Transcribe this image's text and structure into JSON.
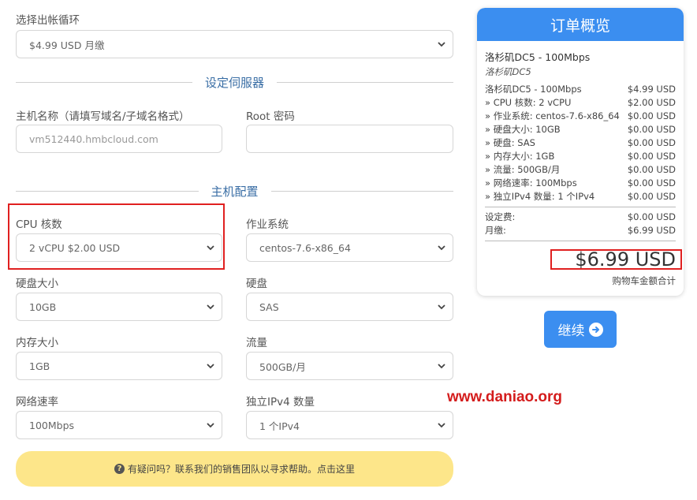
{
  "billing": {
    "label": "选择出帐循环",
    "value": "$4.99 USD 月缴"
  },
  "server_section": {
    "title": "设定伺服器"
  },
  "hostname": {
    "label": "主机名称（请填写域名/子域名格式）",
    "placeholder": "vm512440.hmbcloud.com"
  },
  "root_password": {
    "label": "Root 密码",
    "value": ""
  },
  "config_section": {
    "title": "主机配置"
  },
  "fields": {
    "cpu": {
      "label": "CPU 核数",
      "value": "2 vCPU $2.00 USD"
    },
    "os": {
      "label": "作业系统",
      "value": "centos-7.6-x86_64"
    },
    "disk_size": {
      "label": "硬盘大小",
      "value": "10GB"
    },
    "disk_type": {
      "label": "硬盘",
      "value": "SAS"
    },
    "memory": {
      "label": "内存大小",
      "value": "1GB"
    },
    "traffic": {
      "label": "流量",
      "value": "500GB/月"
    },
    "speed": {
      "label": "网络速率",
      "value": "100Mbps"
    },
    "ipv4": {
      "label": "独立IPv4 数量",
      "value": "1 个IPv4"
    }
  },
  "help": {
    "icon": "question-circle-icon",
    "text": "有疑问吗？联系我们的销售团队以寻求帮助。点击这里"
  },
  "summary": {
    "title": "订单概览",
    "product": "洛杉矶DC5 - 100Mbps",
    "group": "洛杉矶DC5",
    "lines": [
      {
        "label": "洛杉矶DC5 - 100Mbps",
        "price": "$4.99 USD"
      },
      {
        "label": "» CPU 核数: 2 vCPU",
        "price": "$2.00 USD"
      },
      {
        "label": "» 作业系统: centos-7.6-x86_64",
        "price": "$0.00 USD"
      },
      {
        "label": "» 硬盘大小: 10GB",
        "price": "$0.00 USD"
      },
      {
        "label": "» 硬盘: SAS",
        "price": "$0.00 USD"
      },
      {
        "label": "» 内存大小: 1GB",
        "price": "$0.00 USD"
      },
      {
        "label": "» 流量: 500GB/月",
        "price": "$0.00 USD"
      },
      {
        "label": "» 网络速率: 100Mbps",
        "price": "$0.00 USD"
      },
      {
        "label": "» 独立IPv4 数量: 1 个IPv4",
        "price": "$0.00 USD"
      }
    ],
    "setup_fee_label": "设定费:",
    "setup_fee": "$0.00 USD",
    "monthly_label": "月缴:",
    "monthly": "$6.99 USD",
    "total": "$6.99 USD",
    "total_label": "购物车金额合计"
  },
  "continue_button": {
    "label": "继续",
    "icon": "arrow-right-circle-icon"
  },
  "watermark": "www.daniao.org",
  "colors": {
    "accent": "#3b8ef0",
    "highlight": "#e02020",
    "help_bg": "#fde68a",
    "section_title": "#3a6ea5"
  }
}
